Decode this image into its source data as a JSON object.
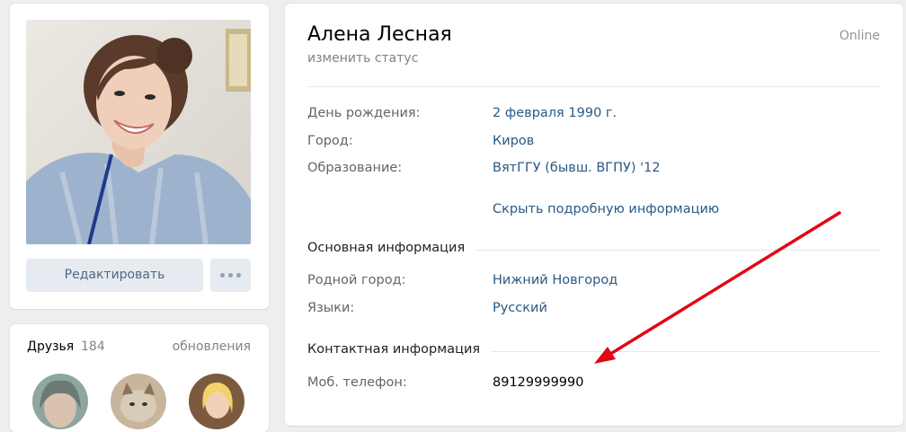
{
  "profile": {
    "name": "Алена Лесная",
    "status_link": "изменить статус",
    "online": "Online",
    "edit_button": "Редактировать"
  },
  "info_rows": [
    {
      "label": "День рождения:",
      "value": "2 февраля 1990 г."
    },
    {
      "label": "Город:",
      "value": "Киров"
    },
    {
      "label": "Образование:",
      "value": "ВятГГУ (бывш. ВГПУ) '12"
    }
  ],
  "hide_details_link": "Скрыть подробную информацию",
  "sections": {
    "basic": {
      "title": "Основная информация",
      "rows": [
        {
          "label": "Родной город:",
          "value": "Нижний Новгород"
        },
        {
          "label": "Языки:",
          "value": "Русский"
        }
      ]
    },
    "contact": {
      "title": "Контактная информация",
      "rows": [
        {
          "label": "Моб. телефон:",
          "value": "89129999990"
        }
      ]
    }
  },
  "friends": {
    "title": "Друзья",
    "count": "184",
    "updates_link": "обновления"
  },
  "colors": {
    "link": "#2a5885",
    "annotation_arrow": "#e30613"
  },
  "icons": {
    "more": "more-dots-icon",
    "arrow": "red-annotation-arrow"
  }
}
